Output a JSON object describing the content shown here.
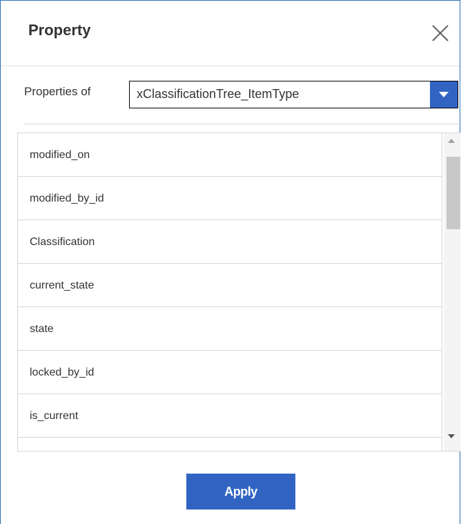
{
  "dialog": {
    "title": "Property",
    "close_icon": "close-icon",
    "accent_color": "#3164c2"
  },
  "properties_of": {
    "label": "Properties of",
    "selected_value": "xClassificationTree_ItemType",
    "dropdown_icon": "chevron-down-icon"
  },
  "property_list": {
    "items": [
      "modified_on",
      "modified_by_id",
      "Classification",
      "current_state",
      "state",
      "locked_by_id",
      "is_current",
      ""
    ]
  },
  "footer": {
    "apply_label": "Apply"
  }
}
